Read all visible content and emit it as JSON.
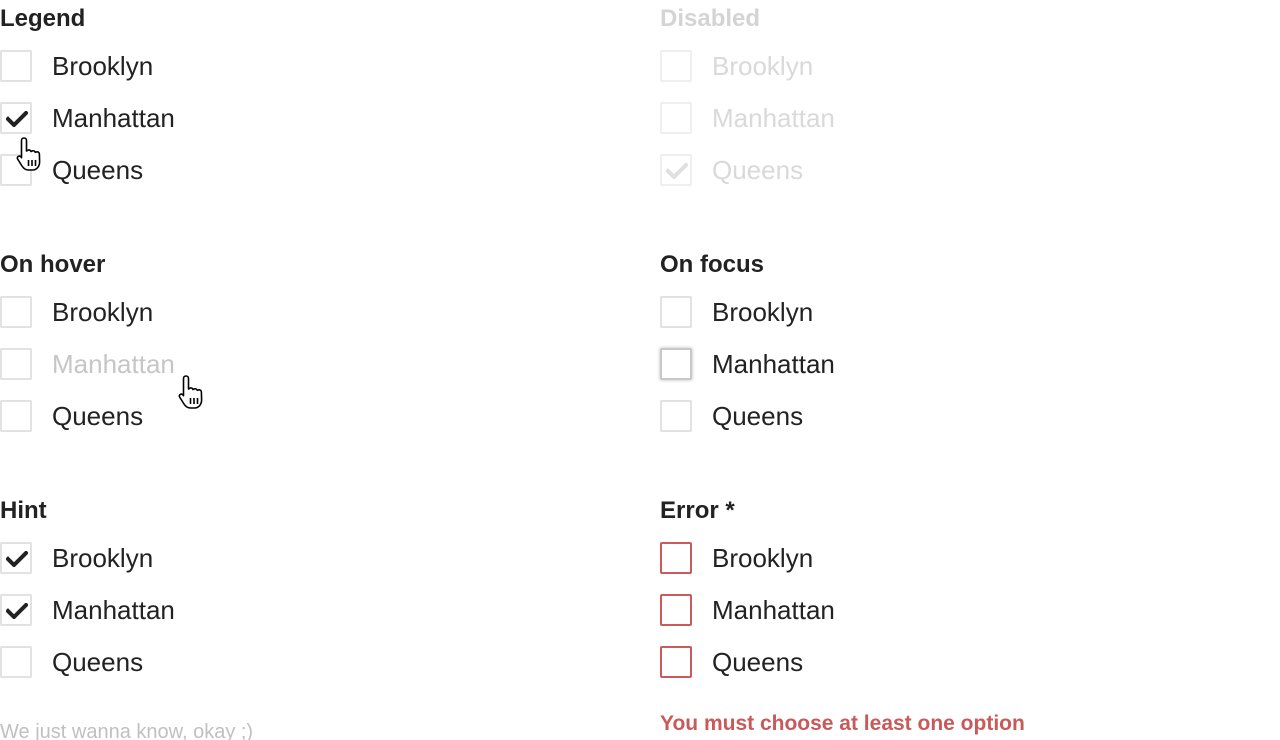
{
  "legend": {
    "title": "Legend",
    "options": [
      {
        "label": "Brooklyn",
        "checked": false
      },
      {
        "label": "Manhattan",
        "checked": true
      },
      {
        "label": "Queens",
        "checked": false
      }
    ]
  },
  "disabled": {
    "title": "Disabled",
    "options": [
      {
        "label": "Brooklyn",
        "checked": false
      },
      {
        "label": "Manhattan",
        "checked": false
      },
      {
        "label": "Queens",
        "checked": true
      }
    ]
  },
  "hover": {
    "title": "On hover",
    "options": [
      {
        "label": "Brooklyn",
        "checked": false
      },
      {
        "label": "Manhattan",
        "checked": false
      },
      {
        "label": "Queens",
        "checked": false
      }
    ]
  },
  "focus": {
    "title": "On focus",
    "options": [
      {
        "label": "Brooklyn",
        "checked": false
      },
      {
        "label": "Manhattan",
        "checked": false
      },
      {
        "label": "Queens",
        "checked": false
      }
    ]
  },
  "hint": {
    "title": "Hint",
    "options": [
      {
        "label": "Brooklyn",
        "checked": true
      },
      {
        "label": "Manhattan",
        "checked": true
      },
      {
        "label": "Queens",
        "checked": false
      }
    ],
    "hint_text": "We just wanna know, okay ;)"
  },
  "error": {
    "title": "Error *",
    "options": [
      {
        "label": "Brooklyn",
        "checked": false
      },
      {
        "label": "Manhattan",
        "checked": false
      },
      {
        "label": "Queens",
        "checked": false
      }
    ],
    "error_text": "You must choose at least one option"
  },
  "colors": {
    "text": "#222222",
    "border": "#e2e2e2",
    "disabled_text": "#d9d9d9",
    "error": "#cc5a5a",
    "hint": "#c0c0c0"
  },
  "icons": {
    "check": "check-icon",
    "cursor": "hand-pointer-icon"
  }
}
